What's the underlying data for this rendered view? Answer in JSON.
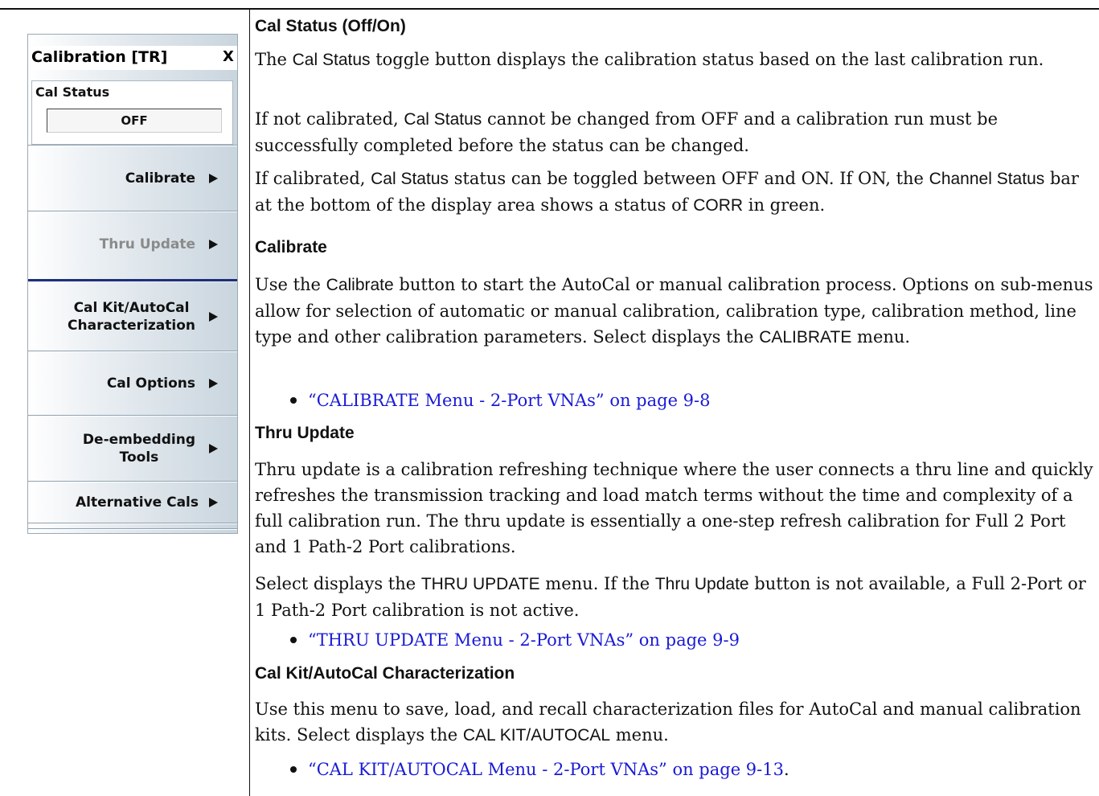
{
  "menu": {
    "title": "Calibration [TR]",
    "close_label": "X",
    "cal_status": {
      "label": "Cal Status",
      "value": "OFF"
    },
    "buttons": [
      {
        "label": "Calibrate",
        "enabled": true
      },
      {
        "label": "Thru Update",
        "enabled": false
      },
      {
        "label": "Cal Kit/AutoCal\nCharacterization",
        "enabled": true
      },
      {
        "label": "Cal Options",
        "enabled": true
      },
      {
        "label": "De-embedding\nTools",
        "enabled": true
      },
      {
        "label": "Alternative Cals",
        "enabled": true
      }
    ]
  },
  "sections": {
    "cal_status": {
      "heading": "Cal Status (Off/On)",
      "p1": [
        "The ",
        "Cal Status",
        " toggle button displays the calibration status based on the last calibration run."
      ],
      "p2": [
        "If not calibrated, ",
        "Cal Status",
        " cannot be changed from OFF and a calibration run must be successfully completed before the status can be changed."
      ],
      "p3": [
        "If calibrated, ",
        "Cal Status",
        " status can be toggled between OFF and ON. If ON, the ",
        "Channel Status",
        " bar at the bottom of the display area shows a status of ",
        "CORR",
        " in green."
      ]
    },
    "calibrate": {
      "heading": "Calibrate",
      "p1": [
        "Use the ",
        "Calibrate",
        " button to start the AutoCal or manual calibration process. Options on sub-menus allow for selection of automatic or manual calibration, calibration type, calibration method, line type and other calibration parameters. Select displays the ",
        "CALIBRATE",
        " menu."
      ],
      "link": "“CALIBRATE Menu - 2-Port VNAs” on page 9-8"
    },
    "thru_update": {
      "heading": "Thru Update",
      "p1": "Thru update is a calibration refreshing technique where the user connects a thru line and quickly refreshes the transmission tracking and load match terms without the time and complexity of a full calibration run. The thru update is essentially a one-step refresh calibration for Full 2 Port and 1 Path-2 Port calibrations.",
      "p2": [
        "Select displays the ",
        "THRU UPDATE",
        " menu. If the ",
        "Thru Update",
        " button is not available, a Full 2-Port or 1 Path-2 Port calibration is not active."
      ],
      "link": "“THRU UPDATE Menu - 2-Port VNAs” on page 9-9"
    },
    "cal_kit": {
      "heading": "Cal Kit/AutoCal Characterization",
      "p1": [
        "Use this menu to save, load, and recall characterization files for AutoCal and manual calibration kits. Select displays the ",
        "CAL KIT/AUTOCAL",
        " menu."
      ],
      "link": "“CAL KIT/AUTOCAL Menu - 2-Port VNAs” on page 9-13",
      "link_suffix": "."
    }
  }
}
